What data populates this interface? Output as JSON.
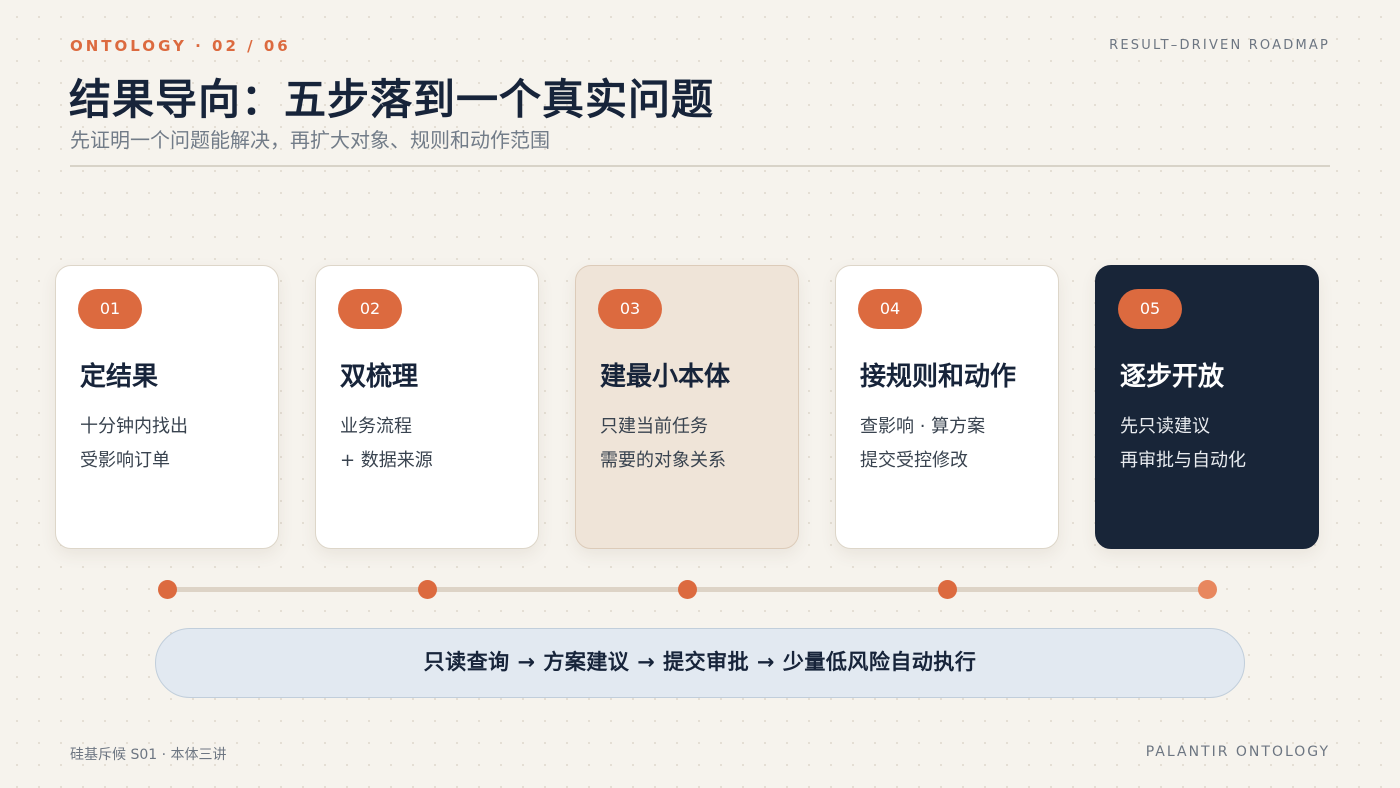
{
  "header": {
    "kicker": "ONTOLOGY · 02 / 06",
    "tag": "RESULT–DRIVEN ROADMAP",
    "title": "结果导向：五步落到一个真实问题",
    "subtitle": "先证明一个问题能解决，再扩大对象、规则和动作范围"
  },
  "steps": [
    {
      "num": "01",
      "title": "定结果",
      "lines": [
        "十分钟内找出",
        "受影响订单"
      ],
      "style": "white"
    },
    {
      "num": "02",
      "title": "双梳理",
      "lines": [
        "业务流程",
        "+ 数据来源"
      ],
      "style": "white"
    },
    {
      "num": "03",
      "title": "建最小本体",
      "lines": [
        "只建当前任务",
        "需要的对象关系"
      ],
      "style": "beige"
    },
    {
      "num": "04",
      "title": "接规则和动作",
      "lines": [
        "查影响 · 算方案",
        "提交受控修改"
      ],
      "style": "white"
    },
    {
      "num": "05",
      "title": "逐步开放",
      "lines": [
        "先只读建议",
        "再审批与自动化"
      ],
      "style": "dark"
    }
  ],
  "flow": {
    "text": "只读查询 → 方案建议 → 提交审批 → 少量低风险自动执行"
  },
  "footer": {
    "left": "硅基斥候 S01 · 本体三讲",
    "right": "PALANTIR ONTOLOGY"
  },
  "colors": {
    "accent": "#dc6a3f",
    "navy": "#182538",
    "beige": "#efe4d8",
    "background": "#f6f3ed",
    "flow_bg": "#e2e9f1"
  }
}
